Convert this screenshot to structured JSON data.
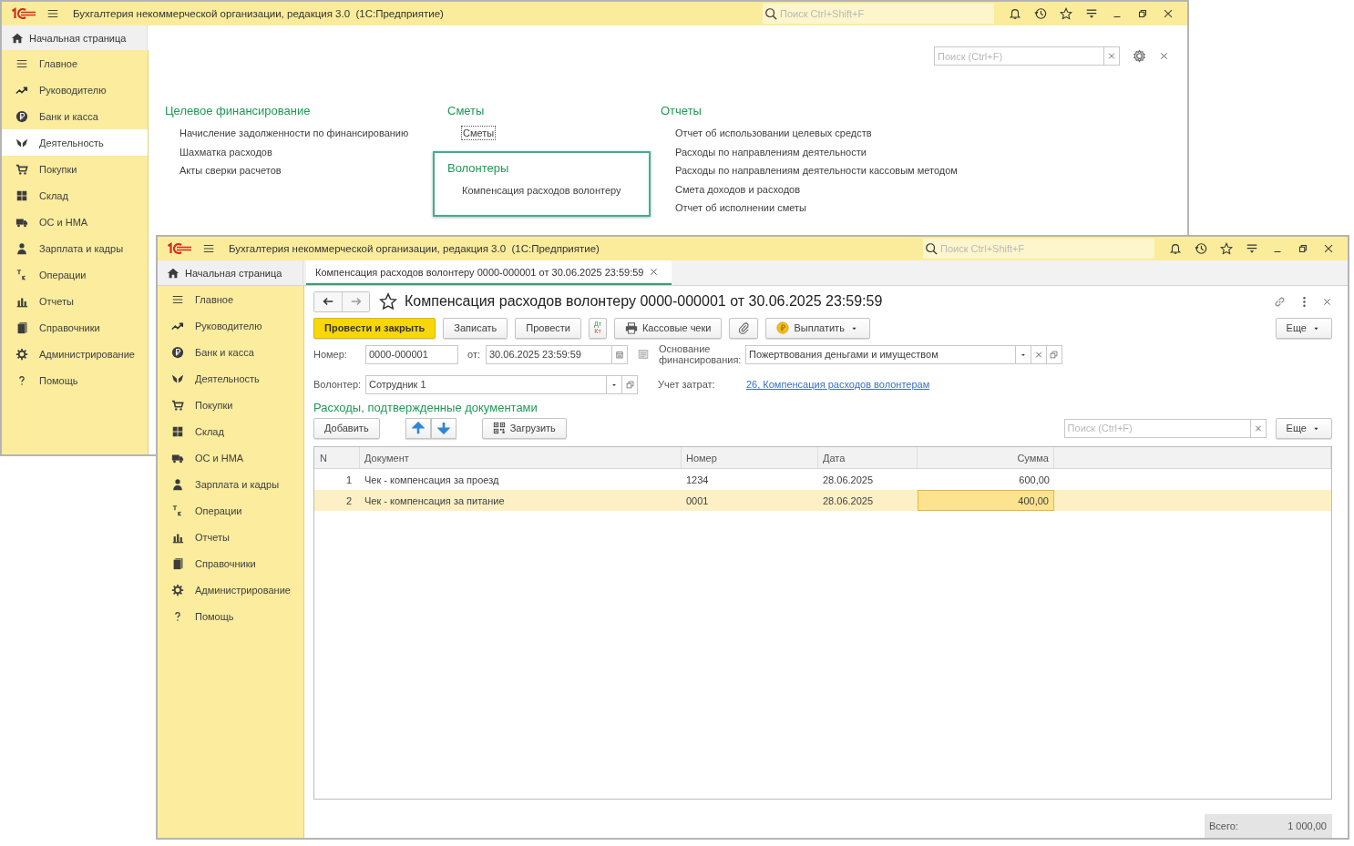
{
  "back_window": {
    "title": "Бухгалтерия некоммерческой организации, редакция 3.0  (1С:Предприятие)",
    "search": {
      "placeholder": "Поиск Ctrl+Shift+F"
    },
    "tabs": [
      {
        "kind": "home",
        "label": "Начальная страница",
        "selected": false,
        "closable": false
      }
    ],
    "sidebar": [
      {
        "label": "Главное",
        "selected": false
      },
      {
        "label": "Руководителю",
        "selected": false
      },
      {
        "label": "Банк и касса",
        "selected": false
      },
      {
        "label": "Деятельность",
        "selected": true
      },
      {
        "label": "Покупки",
        "selected": false
      },
      {
        "label": "Склад",
        "selected": false
      },
      {
        "label": "ОС и НМА",
        "selected": false
      },
      {
        "label": "Зарплата и кадры",
        "selected": false
      },
      {
        "label": "Операции",
        "selected": false
      },
      {
        "label": "Отчеты",
        "selected": false
      },
      {
        "label": "Справочники",
        "selected": false
      },
      {
        "label": "Администрирование",
        "selected": false
      },
      {
        "label": "Помощь",
        "selected": false
      }
    ],
    "panel": {
      "search": {
        "placeholder": "Поиск (Ctrl+F)"
      },
      "columns": [
        [
          {
            "title": "Целевое финансирование",
            "highlighted": false,
            "items": [
              {
                "label": "Начисление задолженности по финансированию",
                "focused": false
              },
              {
                "label": "Шахматка расходов",
                "focused": false
              },
              {
                "label": "Акты сверки расчетов",
                "focused": false
              }
            ]
          }
        ],
        [
          {
            "title": "Сметы",
            "highlighted": false,
            "items": [
              {
                "label": "Сметы",
                "focused": true
              }
            ]
          },
          {
            "title": "Волонтеры",
            "highlighted": true,
            "items": [
              {
                "label": "Компенсация расходов волонтеру",
                "focused": false
              }
            ]
          }
        ],
        [
          {
            "title": "Отчеты",
            "highlighted": false,
            "items": [
              {
                "label": "Отчет об использовании целевых средств",
                "focused": false
              },
              {
                "label": "Расходы по направлениям деятельности",
                "focused": false
              },
              {
                "label": "Расходы по направлениям деятельности кассовым методом",
                "focused": false
              },
              {
                "label": "Смета доходов и расходов",
                "focused": false
              },
              {
                "label": "Отчет об исполнении сметы",
                "focused": false
              }
            ]
          }
        ]
      ]
    }
  },
  "front_window": {
    "title": "Бухгалтерия некоммерческой организации, редакция 3.0  (1С:Предприятие)",
    "search": {
      "placeholder": "Поиск Ctrl+Shift+F"
    },
    "tabs": [
      {
        "kind": "home",
        "label": "Начальная страница",
        "selected": false,
        "closable": false
      },
      {
        "kind": "document",
        "label": "Компенсация расходов волонтеру 0000-000001 от 30.06.2025 23:59:59",
        "selected": true,
        "closable": true
      }
    ],
    "sidebar": [
      {
        "label": "Главное",
        "selected": false
      },
      {
        "label": "Руководителю",
        "selected": false
      },
      {
        "label": "Банк и касса",
        "selected": false
      },
      {
        "label": "Деятельность",
        "selected": false
      },
      {
        "label": "Покупки",
        "selected": false
      },
      {
        "label": "Склад",
        "selected": false
      },
      {
        "label": "ОС и НМА",
        "selected": false
      },
      {
        "label": "Зарплата и кадры",
        "selected": false
      },
      {
        "label": "Операции",
        "selected": false
      },
      {
        "label": "Отчеты",
        "selected": false
      },
      {
        "label": "Справочники",
        "selected": false
      },
      {
        "label": "Администрирование",
        "selected": false
      },
      {
        "label": "Помощь",
        "selected": false
      }
    ],
    "document": {
      "title": "Компенсация расходов волонтеру 0000-000001 от 30.06.2025 23:59:59",
      "favorite": false,
      "toolbar": [
        {
          "kind": "primary",
          "label": "Провести и закрыть"
        },
        {
          "kind": "plain",
          "label": "Записать"
        },
        {
          "kind": "plain",
          "label": "Провести"
        },
        {
          "kind": "dtkt",
          "lines": [
            "Дт",
            "Кт"
          ]
        },
        {
          "kind": "icon_label",
          "label": "Кассовые чеки"
        },
        {
          "kind": "icon"
        },
        {
          "kind": "menu",
          "label": "Выплатить"
        }
      ],
      "more_button": "Еще",
      "number": {
        "label": "Номер:",
        "value": "0000-000001"
      },
      "date": {
        "label": "от:",
        "value": "30.06.2025 23:59:59"
      },
      "funding": {
        "label": "Основание финансирования:",
        "value": "Пожертвования деньгами и имуществом"
      },
      "volunteer": {
        "label": "Волонтер:",
        "value": "Сотрудник 1"
      },
      "cost_account": {
        "label": "Учет затрат:",
        "link": "26, Компенсация расходов волонтерам"
      },
      "expenses": {
        "title": "Расходы, подтвержденные документами",
        "add_button": "Добавить",
        "load_button": "Загрузить",
        "search": {
          "placeholder": "Поиск (Ctrl+F)"
        },
        "more_button": "Еще",
        "columns": [
          "N",
          "Документ",
          "Номер",
          "Дата",
          "Сумма"
        ],
        "rows": [
          {
            "cells": [
              "1",
              "Чек - компенсация за проезд",
              "1234",
              "28.06.2025",
              "600,00"
            ],
            "selected": false
          },
          {
            "cells": [
              "2",
              "Чек - компенсация за питание",
              "0001",
              "28.06.2025",
              "400,00"
            ],
            "selected": true
          }
        ],
        "total": {
          "label": "Всего:",
          "value": "1 000,00"
        }
      }
    }
  }
}
